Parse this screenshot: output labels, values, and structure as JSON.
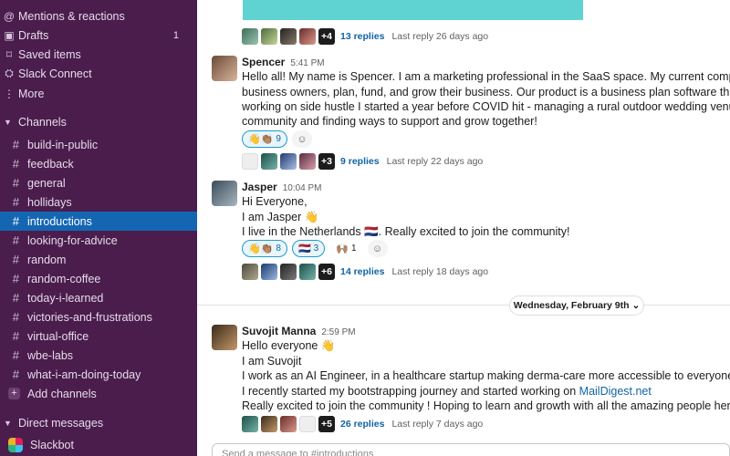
{
  "sidebar": {
    "top_items": [
      {
        "label": "Mentions & reactions",
        "icon": "at-icon",
        "badge": ""
      },
      {
        "label": "Drafts",
        "icon": "drafts-icon",
        "badge": "1"
      },
      {
        "label": "Saved items",
        "icon": "bookmark-icon",
        "badge": ""
      },
      {
        "label": "Slack Connect",
        "icon": "slack-connect-icon",
        "badge": ""
      },
      {
        "label": "More",
        "icon": "more-icon",
        "badge": ""
      }
    ],
    "channels_header": "Channels",
    "channels": [
      "build-in-public",
      "feedback",
      "general",
      "hollidays",
      "introductions",
      "looking-for-advice",
      "random",
      "random-coffee",
      "today-i-learned",
      "victories-and-frustrations",
      "virtual-office",
      "wbe-labs",
      "what-i-am-doing-today"
    ],
    "active_channel": "introductions",
    "add_channels": "Add channels",
    "dm_header": "Direct messages",
    "dms": [
      "Slackbot"
    ]
  },
  "main": {
    "top_thread": {
      "count": "+4",
      "replies": "13 replies",
      "last": "Last reply 26 days ago"
    },
    "messages": [
      {
        "name": "Spencer",
        "time": "5:41 PM",
        "lines": [
          "Hello all! My name is Spencer. I am a marketing professional in the SaaS space. My current company I work",
          "business owners, plan, fund, and grow their business. Our product is a business plan software that grows w",
          "working on side hustle I started a year before COVID hit - managing a rural outdoor wedding venue. Looki",
          "community and finding ways to support and grow together!"
        ],
        "reactions": [
          {
            "emoji": "👋👏🏽",
            "count": "9",
            "mine": true
          }
        ],
        "thread": {
          "count": "+3",
          "replies": "9 replies",
          "last": "Last reply 22 days ago"
        }
      },
      {
        "name": "Jasper",
        "time": "10:04 PM",
        "lines": [
          "Hi Everyone,",
          "I am Jasper 👋",
          "I live in the Netherlands 🇳🇱. Really excited to join the community!"
        ],
        "reactions": [
          {
            "emoji": "👋👏🏽",
            "count": "8",
            "mine": true
          },
          {
            "emoji": "🇳🇱",
            "count": "3",
            "mine": true
          },
          {
            "emoji": "🙌🏽",
            "count": "1",
            "mine": false
          }
        ],
        "thread": {
          "count": "+6",
          "replies": "14 replies",
          "last": "Last reply 18 days ago"
        }
      },
      {
        "name": "Suvojit Manna",
        "time": "2:59 PM",
        "lines": [
          "Hello everyone 👋",
          "I am Suvojit",
          "I work as an AI Engineer, in a healthcare startup making derma-care more accessible to everyone in India.",
          "I recently started my bootstrapping journey and started working on ",
          "Really excited to join the community ! Hoping to learn and growth with all the amazing people here."
        ],
        "link": "MailDigest.net",
        "thread": {
          "count": "+5",
          "replies": "26 replies",
          "last": "Last reply 7 days ago"
        }
      }
    ],
    "date_divider": "Wednesday, February 9th",
    "composer_placeholder": "Send a message to #introductions"
  },
  "colors": {
    "sidebar_bg": "#4a1d4d",
    "active": "#1566b2",
    "link": "#1264a3"
  }
}
